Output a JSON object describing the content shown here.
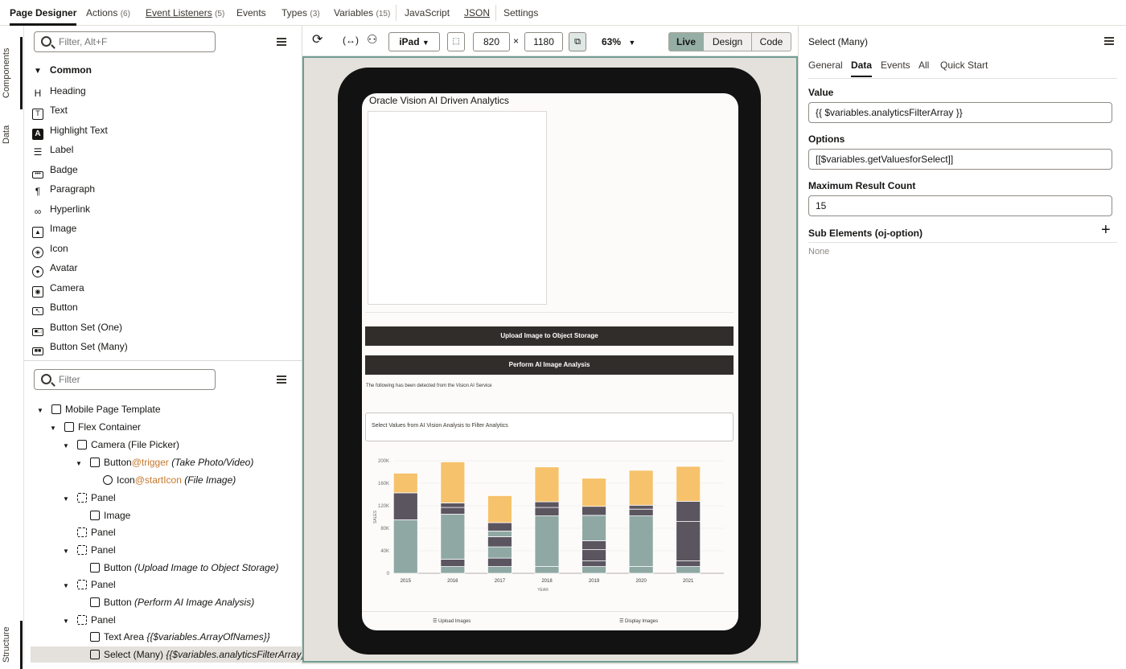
{
  "top_tabs": [
    {
      "label": "Page Designer",
      "count": ""
    },
    {
      "label": "Actions",
      "count": "(6)"
    },
    {
      "label": "Event Listeners",
      "count": "(5)"
    },
    {
      "label": "Events",
      "count": ""
    },
    {
      "label": "Types",
      "count": "(3)"
    },
    {
      "label": "Variables",
      "count": "(15)"
    },
    {
      "label": "JavaScript",
      "count": ""
    },
    {
      "label": "JSON",
      "count": ""
    },
    {
      "label": "Settings",
      "count": ""
    }
  ],
  "side_tabs": {
    "components": "Components",
    "data": "Data",
    "structure": "Structure"
  },
  "components": {
    "search_placeholder": "Filter, Alt+F",
    "group": "Common",
    "items": [
      "Heading",
      "Text",
      "Highlight Text",
      "Label",
      "Badge",
      "Paragraph",
      "Hyperlink",
      "Image",
      "Icon",
      "Avatar",
      "Camera",
      "Button",
      "Button Set (One)",
      "Button Set (Many)"
    ]
  },
  "structure": {
    "search_placeholder": "Filter",
    "items": [
      {
        "label": "Mobile Page Template",
        "slot": "",
        "detail": ""
      },
      {
        "label": "Flex Container",
        "slot": "",
        "detail": ""
      },
      {
        "label": "Camera (File Picker)",
        "slot": "",
        "detail": ""
      },
      {
        "label": "Button",
        "slot": "@trigger",
        "detail": "(Take Photo/Video)"
      },
      {
        "label": "Icon",
        "slot": "@startIcon",
        "detail": "(File Image)"
      },
      {
        "label": "Panel",
        "slot": "",
        "detail": ""
      },
      {
        "label": "Image",
        "slot": "",
        "detail": ""
      },
      {
        "label": "Panel",
        "slot": "",
        "detail": ""
      },
      {
        "label": "Panel",
        "slot": "",
        "detail": ""
      },
      {
        "label": "Button",
        "slot": "",
        "detail": "(Upload Image to Object Storage)"
      },
      {
        "label": "Panel",
        "slot": "",
        "detail": ""
      },
      {
        "label": "Button",
        "slot": "",
        "detail": "(Perform AI Image Analysis)"
      },
      {
        "label": "Panel",
        "slot": "",
        "detail": ""
      },
      {
        "label": "Text Area",
        "slot": "",
        "detail": "{{$variables.ArrayOfNames}}"
      },
      {
        "label": "Select (Many)",
        "slot": "",
        "detail": "{{$variables.analyticsFilterArray}}"
      }
    ]
  },
  "toolbar": {
    "device": "iPad",
    "width": "820",
    "times": "×",
    "height": "1180",
    "zoom": "63%",
    "modes": [
      "Live",
      "Design",
      "Code"
    ]
  },
  "preview": {
    "title": "Oracle Vision AI Driven Analytics",
    "upload_button": "Upload Image to Object Storage",
    "analyze_button": "Perform AI Image Analysis",
    "detected_text": "The following has been detected from the Vision AI Service",
    "select_placeholder": "Select Values from AI Vision Analysis to Filter Analytics",
    "nav_upload": "Upload Images",
    "nav_display": "Display Images"
  },
  "chart_data": {
    "type": "bar",
    "stacked": true,
    "categories": [
      "2015",
      "2016",
      "2017",
      "2018",
      "2019",
      "2020",
      "2021"
    ],
    "series": [
      {
        "values": [
          95000,
          12000,
          12000,
          12000,
          12000,
          12000,
          12000
        ]
      },
      {
        "values": [
          0,
          13000,
          15000,
          0,
          10000,
          0,
          10000
        ]
      },
      {
        "values": [
          0,
          80000,
          20000,
          90000,
          0,
          90000,
          0
        ]
      },
      {
        "values": [
          0,
          12000,
          18000,
          0,
          20000,
          0,
          70000
        ]
      },
      {
        "values": [
          48000,
          0,
          0,
          0,
          16000,
          0,
          0
        ]
      },
      {
        "values": [
          0,
          0,
          10000,
          0,
          0,
          0,
          0
        ]
      },
      {
        "values": [
          0,
          0,
          0,
          0,
          45000,
          0,
          0
        ]
      },
      {
        "values": [
          0,
          0,
          15000,
          15000,
          0,
          12000,
          36000
        ]
      },
      {
        "values": [
          0,
          8000,
          0,
          10000,
          16000,
          7000,
          0
        ]
      },
      {
        "values": [
          35000,
          73000,
          48000,
          62000,
          50000,
          62000,
          62000
        ]
      }
    ],
    "series_colors": [
      "#8fa8a3",
      "#5b5560",
      "#8fa8a3",
      "#5b5560",
      "#5b5560",
      "#8fa8a3",
      "#8fa8a3",
      "#5b5560",
      "#5b5560",
      "#f6c26b"
    ],
    "yticks": [
      "0",
      "40K",
      "80K",
      "120K",
      "160K",
      "200K"
    ],
    "ylim": [
      0,
      200000
    ],
    "xlabel": "YEAR",
    "ylabel": "SALES"
  },
  "properties": {
    "title": "Select (Many)",
    "tabs": [
      "General",
      "Data",
      "Events",
      "All",
      "Quick Start"
    ],
    "value_label": "Value",
    "value": "{{ $variables.analyticsFilterArray }}",
    "options_label": "Options",
    "options": "[[$variables.getValuesforSelect]]",
    "max_label": "Maximum Result Count",
    "max": "15",
    "sub_label": "Sub Elements (oj-option)",
    "sub_value": "None"
  },
  "colors": {
    "live_accent": "#94aea6",
    "slot": "#c7772b",
    "button_dark": "#312d2a"
  }
}
